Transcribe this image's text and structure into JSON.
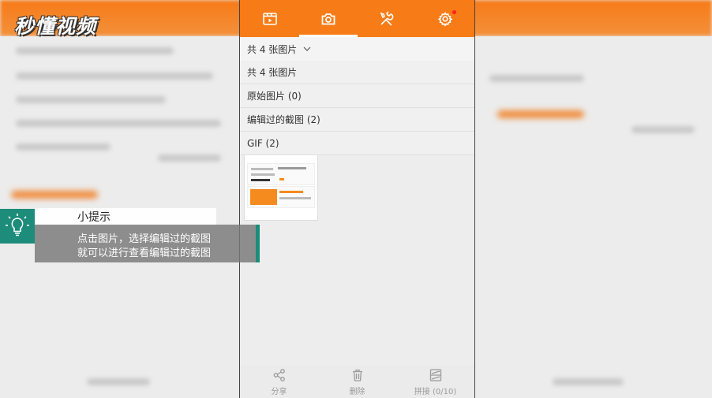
{
  "watermark": {
    "logo_text": "秒懂视频"
  },
  "tabs": [
    {
      "icon": "video-icon",
      "active": false
    },
    {
      "icon": "camera-icon",
      "active": true
    },
    {
      "icon": "tools-icon",
      "active": false
    },
    {
      "icon": "gear-icon",
      "active": false,
      "badge": true
    }
  ],
  "dropdown": {
    "selected": "共 4 张图片",
    "options": [
      "共 4 张图片",
      "原始图片 (0)",
      "编辑过的截图 (2)",
      "GIF (2)"
    ]
  },
  "bottom_bar": {
    "share_label": "分享",
    "delete_label": "删除",
    "stitch_label": "拼接 (0/10)"
  },
  "tip": {
    "title": "小提示",
    "line1": "点击图片，选择编辑过的截图",
    "line2": "就可以进行查看编辑过的截图"
  },
  "colors": {
    "accent": "#f77b16",
    "tip_teal": "#1d8c7a",
    "badge_red": "#ff1f1f"
  }
}
